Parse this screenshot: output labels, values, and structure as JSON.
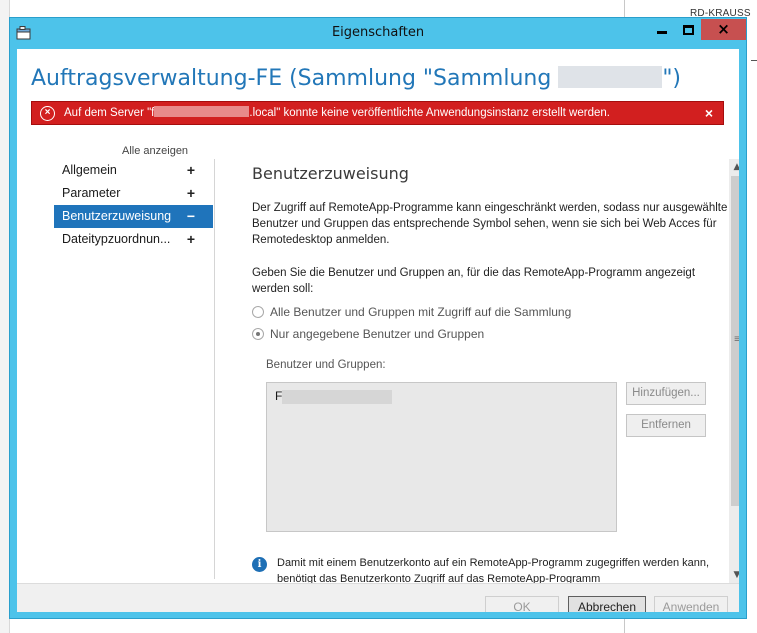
{
  "background": {
    "topright_text": "RD-KRAUSS"
  },
  "window": {
    "title": "Eigenschaften",
    "controls": {
      "close_glyph": "×"
    }
  },
  "header": {
    "title_prefix": "Auftragsverwaltung-FE (Sammlung \"Sammlung ",
    "title_suffix": "\")"
  },
  "error": {
    "text_before": "Auf dem Server \"f",
    "text_after": ".local\" konnte keine veröffentlichte Anwendungsinstanz erstellt werden.",
    "close_glyph": "×",
    "icon_glyph": "×"
  },
  "sidebar": {
    "show_all": "Alle anzeigen",
    "items": [
      {
        "label": "Allgemein",
        "toggle": "+"
      },
      {
        "label": "Parameter",
        "toggle": "+"
      },
      {
        "label": "Benutzerzuweisung",
        "toggle": "−",
        "active": true
      },
      {
        "label": "Dateitypzuordnun...",
        "toggle": "+"
      }
    ]
  },
  "main": {
    "section_title": "Benutzerzuweisung",
    "description": "Der Zugriff auf RemoteApp-Programme kann eingeschränkt werden, sodass nur ausgewählte Benutzer und Gruppen das entsprechende Symbol sehen, wenn sie sich bei Web Acces für Remotedesktop anmelden.",
    "prompt": "Geben Sie die Benutzer und Gruppen an, für die das RemoteApp-Programm angezeigt werden soll:",
    "radio_all": "Alle Benutzer und Gruppen mit Zugriff auf die Sammlung",
    "radio_specific": "Nur angegebene Benutzer und Gruppen",
    "selected_radio": "specific",
    "group_label": "Benutzer und Gruppen:",
    "list_entry_prefix": "F",
    "add_button": "Hinzufügen...",
    "remove_button": "Entfernen",
    "info_text": "Damit mit einem Benutzerkonto auf ein RemoteApp-Programm zugegriffen werden kann, benötigt das Benutzerkonto Zugriff auf das RemoteApp-Programm",
    "info_glyph": "i"
  },
  "scrollbar": {
    "up": "▲",
    "down": "▼",
    "grip": "≡"
  },
  "footer": {
    "ok": "OK",
    "cancel": "Abbrechen",
    "apply": "Anwenden"
  },
  "colors": {
    "window_frame": "#4dc3ea",
    "title_accent": "#2277b8",
    "error_bar": "#d21f1f",
    "nav_active": "#1f74bb",
    "close_button": "#c75050"
  },
  "icons": {
    "app": "properties-window-icon",
    "error": "error-circle-icon",
    "info": "info-circle-icon"
  }
}
